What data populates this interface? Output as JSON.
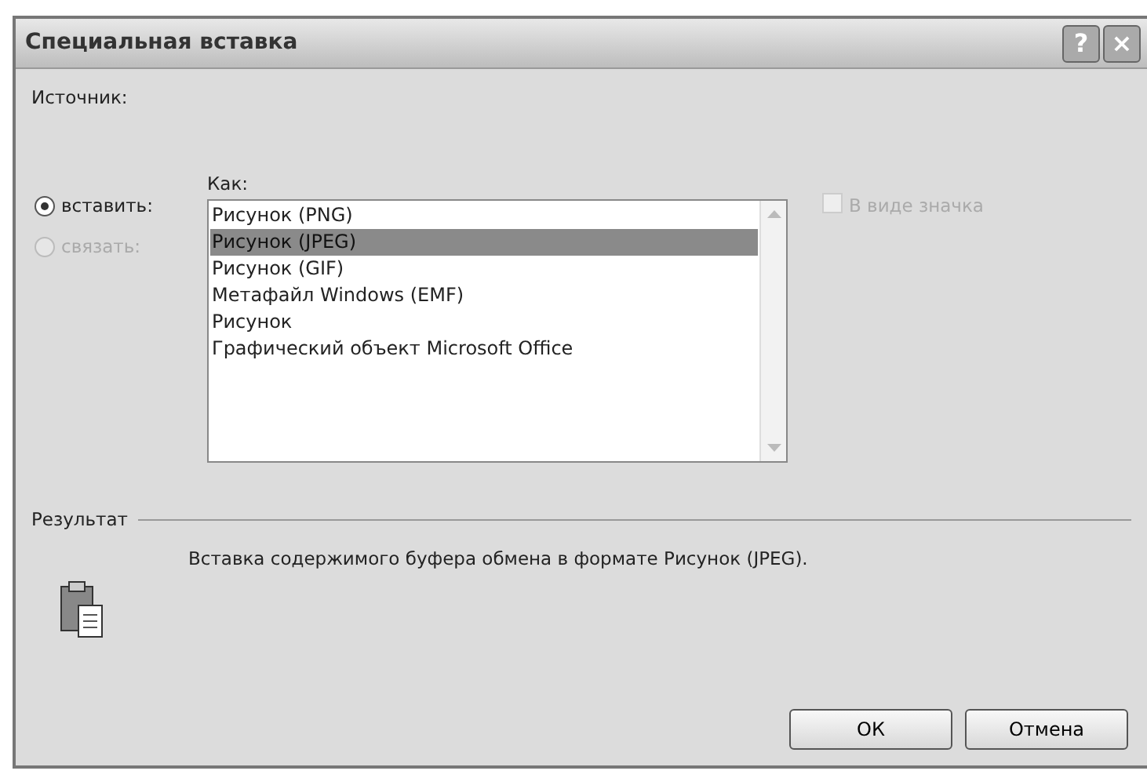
{
  "window": {
    "title": "Специальная вставка",
    "buttons": [
      "?",
      "×"
    ]
  },
  "source": {
    "label": "Источник:"
  },
  "mode": [
    {
      "label": "вставить:",
      "selected": true,
      "disabled": false
    },
    {
      "label": "связать:",
      "selected": false,
      "disabled": true
    }
  ],
  "format": {
    "label": "Как:",
    "items": [
      {
        "label": "Рисунок (PNG)",
        "selected": false
      },
      {
        "label": "Рисунок (JPEG)",
        "selected": true
      },
      {
        "label": "Рисунок (GIF)",
        "selected": false
      },
      {
        "label": "Метафайл Windows (EMF)",
        "selected": false
      },
      {
        "label": "Рисунок",
        "selected": false
      },
      {
        "label": "Графический объект Microsoft Office",
        "selected": false
      }
    ]
  },
  "as_icon": {
    "label": "В виде значка",
    "checked": false,
    "disabled": true
  },
  "result": {
    "label": "Результат",
    "text": "Вставка содержимого буфера обмена в формате Рисунок (JPEG)."
  },
  "buttons": [
    "ОК",
    "Отмена"
  ]
}
